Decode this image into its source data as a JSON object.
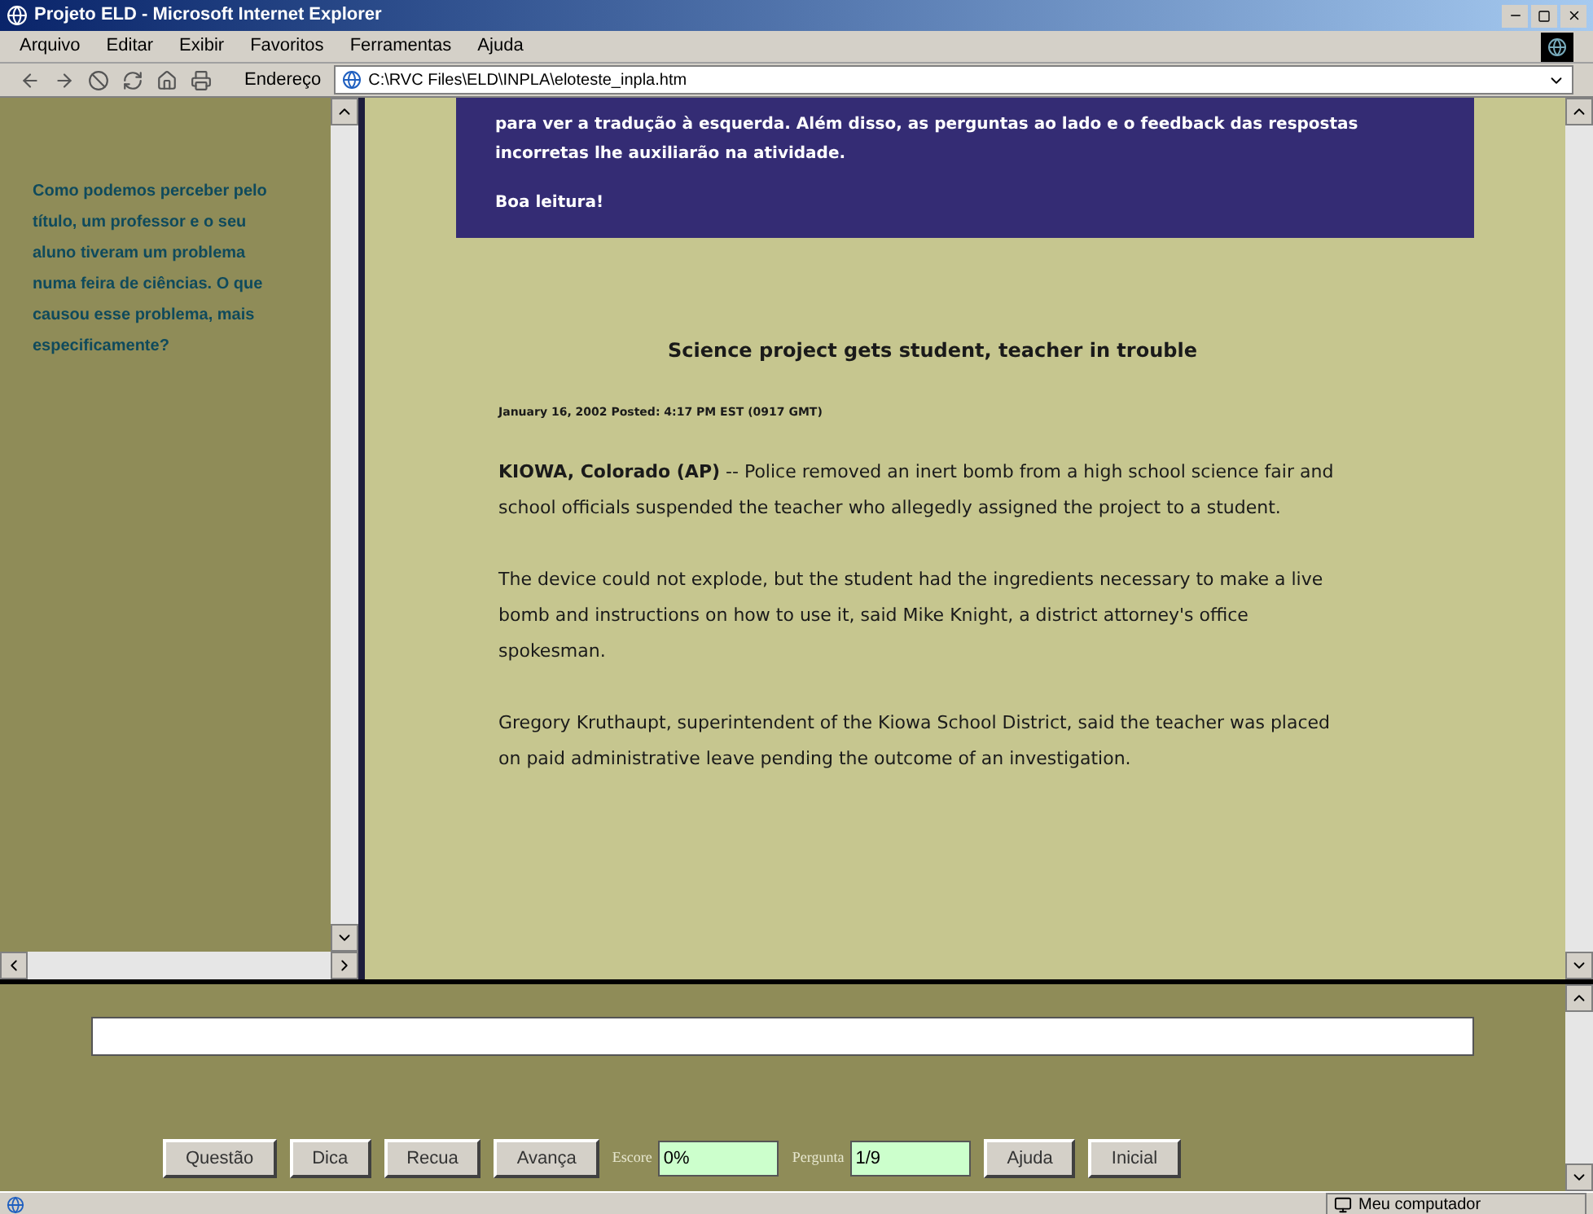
{
  "window": {
    "title": "Projeto ELD - Microsoft Internet Explorer"
  },
  "menu": [
    "Arquivo",
    "Editar",
    "Exibir",
    "Favoritos",
    "Ferramentas",
    "Ajuda"
  ],
  "address_bar": {
    "label": "Endereço",
    "value": "C:\\RVC Files\\ELD\\INPLA\\eloteste_inpla.htm"
  },
  "left_frame": {
    "question": "Como podemos perceber pelo título, um professor e o seu aluno tiveram um problema numa feira de ciências. O que causou esse problema, mais especificamente?"
  },
  "intro_box": {
    "lines": [
      "para ver a tradução à esquerda. Além disso, as perguntas ao lado e o feedback das respostas incorretas lhe auxiliarão na atividade.",
      "Boa leitura!"
    ]
  },
  "article": {
    "headline": "Science project gets student, teacher in trouble",
    "dateline": "January 16, 2002 Posted: 4:17 PM EST (0917 GMT)",
    "paragraphs": [
      "**KIOWA, Colorado (AP)** -- Police removed an inert bomb from a high school science fair and school officials suspended the teacher who allegedly assigned the project to a student.",
      "The device could not explode, but the student had the ingredients necessary to make a live bomb and instructions on how to use it, said Mike Knight, a district attorney's office spokesman.",
      "Gregory Kruthaupt, superintendent of the Kiowa School District, said the teacher was placed on paid administrative leave pending the outcome of an investigation."
    ]
  },
  "controls": [
    {
      "kind": "button",
      "label": "Questão"
    },
    {
      "kind": "button",
      "label": "Dica"
    },
    {
      "kind": "button",
      "label": "Recua"
    },
    {
      "kind": "button",
      "label": "Avança"
    },
    {
      "kind": "field",
      "label": "Escore",
      "value": "0%"
    },
    {
      "kind": "field",
      "label": "Pergunta",
      "value": "1/9"
    },
    {
      "kind": "button",
      "label": "Ajuda"
    },
    {
      "kind": "button",
      "label": "Inicial"
    }
  ],
  "status_bar": {
    "zone": "Meu computador"
  }
}
